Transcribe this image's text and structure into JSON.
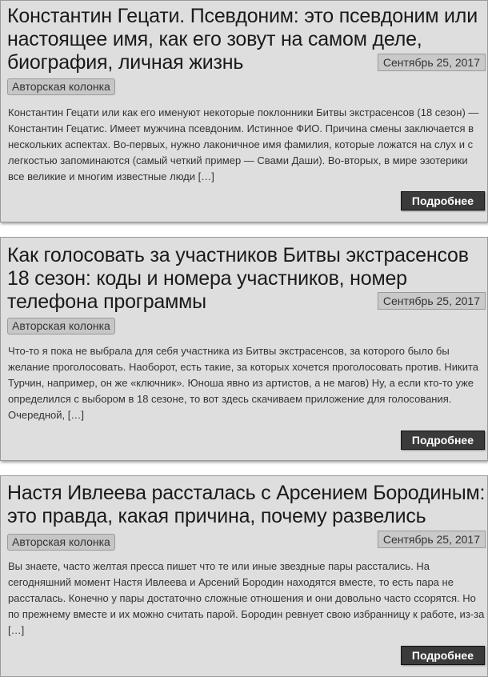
{
  "posts": [
    {
      "title": "Константин Гецати. Псевдоним: это псевдоним или настоящее имя, как его зовут на самом деле, биография, личная жизнь",
      "date": "Сентябрь 25, 2017",
      "category": "Авторская колонка",
      "excerpt": "Константин Гецати или как его именуют некоторые поклонники Битвы экстрасенсов (18 сезон) — Константин Гецатис. Имеет мужчина псевдоним. Истинное ФИО. Причина смены заключается в нескольких аспектах. Во-первых, нужно лаконичное имя фамилия, которые ложатся на слух и с легкостью запоминаются (самый четкий пример — Свами Даши). Во-вторых, в мире эзотерики все великие и многим известные люди […]",
      "more_label": "Подробнее"
    },
    {
      "title": "Как голосовать за участников Битвы экстрасенсов 18 сезон: коды и номера участников, номер телефона программы",
      "date": "Сентябрь 25, 2017",
      "category": "Авторская колонка",
      "excerpt": "Что-то я пока не выбрала для себя участника из Битвы экстрасенсов, за которого было бы желание проголосовать. Наоборот, есть такие, за которых хочется проголосовать против. Никита Турчин, например, он же «ключник». Юноша явно из артистов, а не магов) Ну, а если кто-то уже определился с выбором в 18 сезоне, то вот здесь скачиваем приложение для голосования. Очередной, […]",
      "more_label": "Подробнее"
    },
    {
      "title": "Настя Ивлеева рассталась с Арсением Бородиным: это правда, какая причина, почему развелись",
      "date": "Сентябрь 25, 2017",
      "category": "Авторская колонка",
      "excerpt": "Вы знаете, часто желтая пресса пишет что те или иные звездные пары расстались. На сегодняшний момент Настя Ивлеева и Арсений Бородин находятся вместе, то есть пара не рассталась. Конечно у пары достаточно сложные отношения и они довольно часто ссорятся. Но по прежнему вместе и их можно считать парой. Бородин ревнует свою избранницу к работе, из-за […]",
      "more_label": "Подробнее"
    }
  ]
}
